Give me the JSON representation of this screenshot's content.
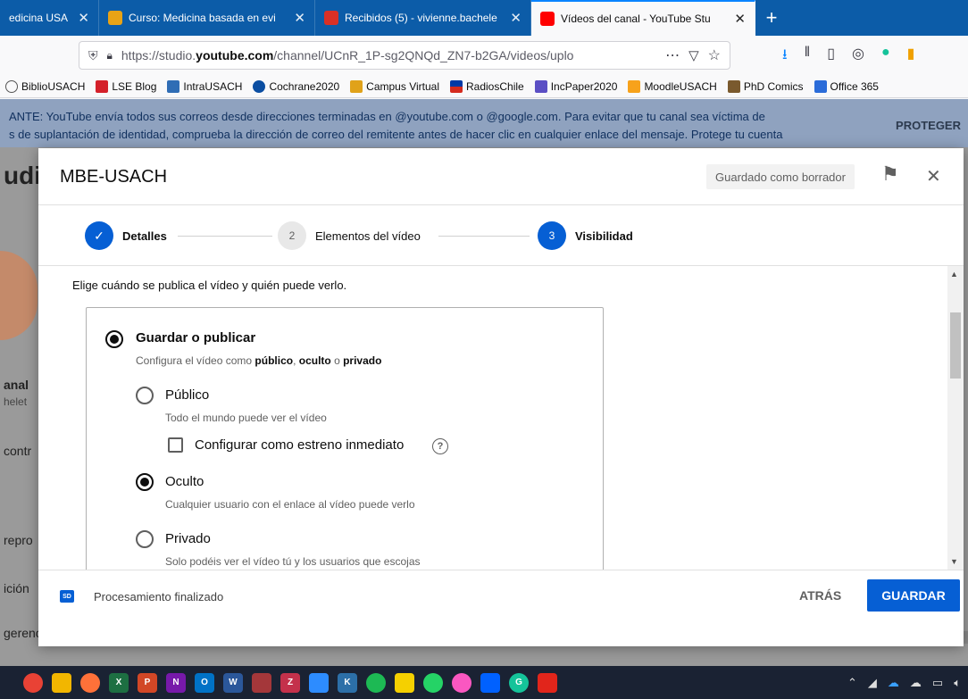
{
  "browser": {
    "tabs": [
      {
        "title": "edicina USA",
        "active": false,
        "favicon_color": "#c4161c"
      },
      {
        "title": "Curso: Medicina basada en evi",
        "active": false,
        "favicon_color": "#e8a316"
      },
      {
        "title": "Recibidos (5) - vivienne.bachele",
        "active": false,
        "favicon_color": "#d93025"
      },
      {
        "title": "Vídeos del canal - YouTube Stu",
        "active": true,
        "favicon_color": "#ff0000"
      }
    ],
    "close_glyph": "✕",
    "new_tab_glyph": "+",
    "url_prefix": "https://studio.",
    "url_domain": "youtube.com",
    "url_rest": "/channel/UCnR_1P-sg2QNQd_ZN7-b2GA/videos/uplo",
    "bookmarks": [
      {
        "label": "BiblioUSACH",
        "color": "#555555"
      },
      {
        "label": "LSE Blog",
        "color": "#d4202a"
      },
      {
        "label": "IntraUSACH",
        "color": "#2f6db5"
      },
      {
        "label": "Cochrane2020",
        "color": "#0b4ea2"
      },
      {
        "label": "Campus Virtual",
        "color": "#e0a21a"
      },
      {
        "label": "RadiosChile",
        "color": "#d52b1e"
      },
      {
        "label": "IncPaper2020",
        "color": "#5b4fc4"
      },
      {
        "label": "MoodleUSACH",
        "color": "#f7a21b"
      },
      {
        "label": "PhD Comics",
        "color": "#7a5a2e"
      },
      {
        "label": "Office 365",
        "color": "#2b6cd9"
      }
    ]
  },
  "page": {
    "notice_line1": "ANTE: YouTube envía todos sus correos desde direcciones terminadas en @youtube.com o @google.com. Para evitar que tu canal sea víctima de",
    "notice_line2": "s de suplantación de identidad, comprueba la dirección de correo del remitente antes de hacer clic en cualquier enlace del mensaje. Protege tu cuenta",
    "protect_label": "PROTEGER",
    "side_studio": "udi",
    "side_canal": "anal",
    "side_name": "helet",
    "side_contr": "contr",
    "side_repro": "repro",
    "side_cion": "ición",
    "side_sugerencias": "gerencias"
  },
  "modal": {
    "title": "MBE-USACH",
    "draft_status": "Guardado como borrador",
    "steps": [
      {
        "number": "✓",
        "label": "Detalles",
        "state": "done"
      },
      {
        "number": "2",
        "label": "Elementos del vídeo",
        "state": "pending"
      },
      {
        "number": "3",
        "label": "Visibilidad",
        "state": "current"
      }
    ],
    "intro": "Elige cuándo se publica el vídeo y quién puede verlo.",
    "save_publish": {
      "label": "Guardar o publicar",
      "desc_prefix": "Configura el vídeo como ",
      "desc_public": "público",
      "desc_sep": ", ",
      "desc_hidden": "oculto",
      "desc_or": " o ",
      "desc_private": "privado"
    },
    "options": {
      "public_label": "Público",
      "public_desc": "Todo el mundo puede ver el vídeo",
      "premiere_label": "Configurar como estreno inmediato",
      "hidden_label": "Oculto",
      "hidden_desc": "Cualquier usuario con el enlace al vídeo puede verlo",
      "private_label": "Privado",
      "private_desc": "Solo podéis ver el vídeo tú y los usuarios que escojas"
    },
    "selected_option": "Oculto",
    "footer": {
      "badge": "SD",
      "processing": "Procesamiento finalizado",
      "back": "ATRÁS",
      "save": "GUARDAR"
    }
  },
  "taskbar": {
    "apps": [
      {
        "name": "chrome",
        "color": "#e94235",
        "round": true,
        "glyph": ""
      },
      {
        "name": "file-explorer",
        "color": "#f2b600",
        "round": false,
        "glyph": ""
      },
      {
        "name": "firefox",
        "color": "#ff7139",
        "round": true,
        "glyph": ""
      },
      {
        "name": "excel",
        "color": "#1d6f42",
        "round": false,
        "glyph": "X"
      },
      {
        "name": "powerpoint",
        "color": "#d24726",
        "round": false,
        "glyph": "P"
      },
      {
        "name": "onenote",
        "color": "#7719aa",
        "round": false,
        "glyph": "N"
      },
      {
        "name": "outlook",
        "color": "#0072c6",
        "round": false,
        "glyph": "O"
      },
      {
        "name": "word",
        "color": "#2b579a",
        "round": false,
        "glyph": "W"
      },
      {
        "name": "access",
        "color": "#a4373a",
        "round": false,
        "glyph": ""
      },
      {
        "name": "app-red",
        "color": "#c4314b",
        "round": false,
        "glyph": "Z"
      },
      {
        "name": "zoom",
        "color": "#2d8cff",
        "round": false,
        "glyph": ""
      },
      {
        "name": "app-k",
        "color": "#2c6fa8",
        "round": false,
        "glyph": "K"
      },
      {
        "name": "spotify",
        "color": "#1db954",
        "round": true,
        "glyph": ""
      },
      {
        "name": "sticky",
        "color": "#f5d000",
        "round": false,
        "glyph": ""
      },
      {
        "name": "whatsapp",
        "color": "#25d366",
        "round": true,
        "glyph": ""
      },
      {
        "name": "itunes",
        "color": "#fa57c1",
        "round": true,
        "glyph": ""
      },
      {
        "name": "dropbox",
        "color": "#0061ff",
        "round": false,
        "glyph": ""
      },
      {
        "name": "grammarly",
        "color": "#15c39a",
        "round": true,
        "glyph": "G"
      },
      {
        "name": "acrobat",
        "color": "#e1251b",
        "round": false,
        "glyph": ""
      }
    ]
  },
  "colors": {
    "accent": "#065fd4",
    "tabbar": "#0c5ca8"
  }
}
